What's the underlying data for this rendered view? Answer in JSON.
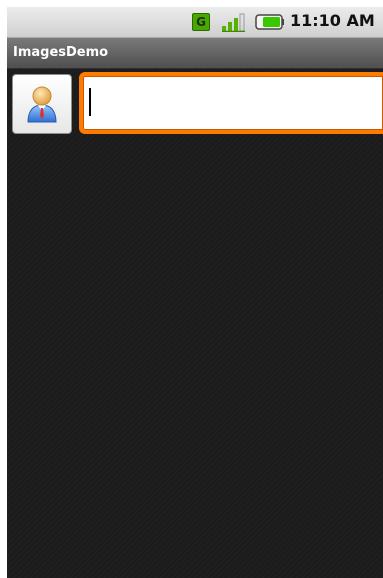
{
  "status_bar": {
    "network_badge": "G",
    "network_icon": "network-type-icon",
    "signal_icon": "signal-strength-icon",
    "battery_icon": "battery-icon",
    "time": "11:10 AM"
  },
  "title_bar": {
    "title": "ImagesDemo"
  },
  "content": {
    "image_button_icon": "contact-person-icon",
    "text_field": {
      "value": "",
      "placeholder": ""
    }
  },
  "colors": {
    "focus_accent": "#ff7a00",
    "network_badge": "#47a800",
    "battery": "#37c800",
    "background": "#1c1c1c"
  }
}
